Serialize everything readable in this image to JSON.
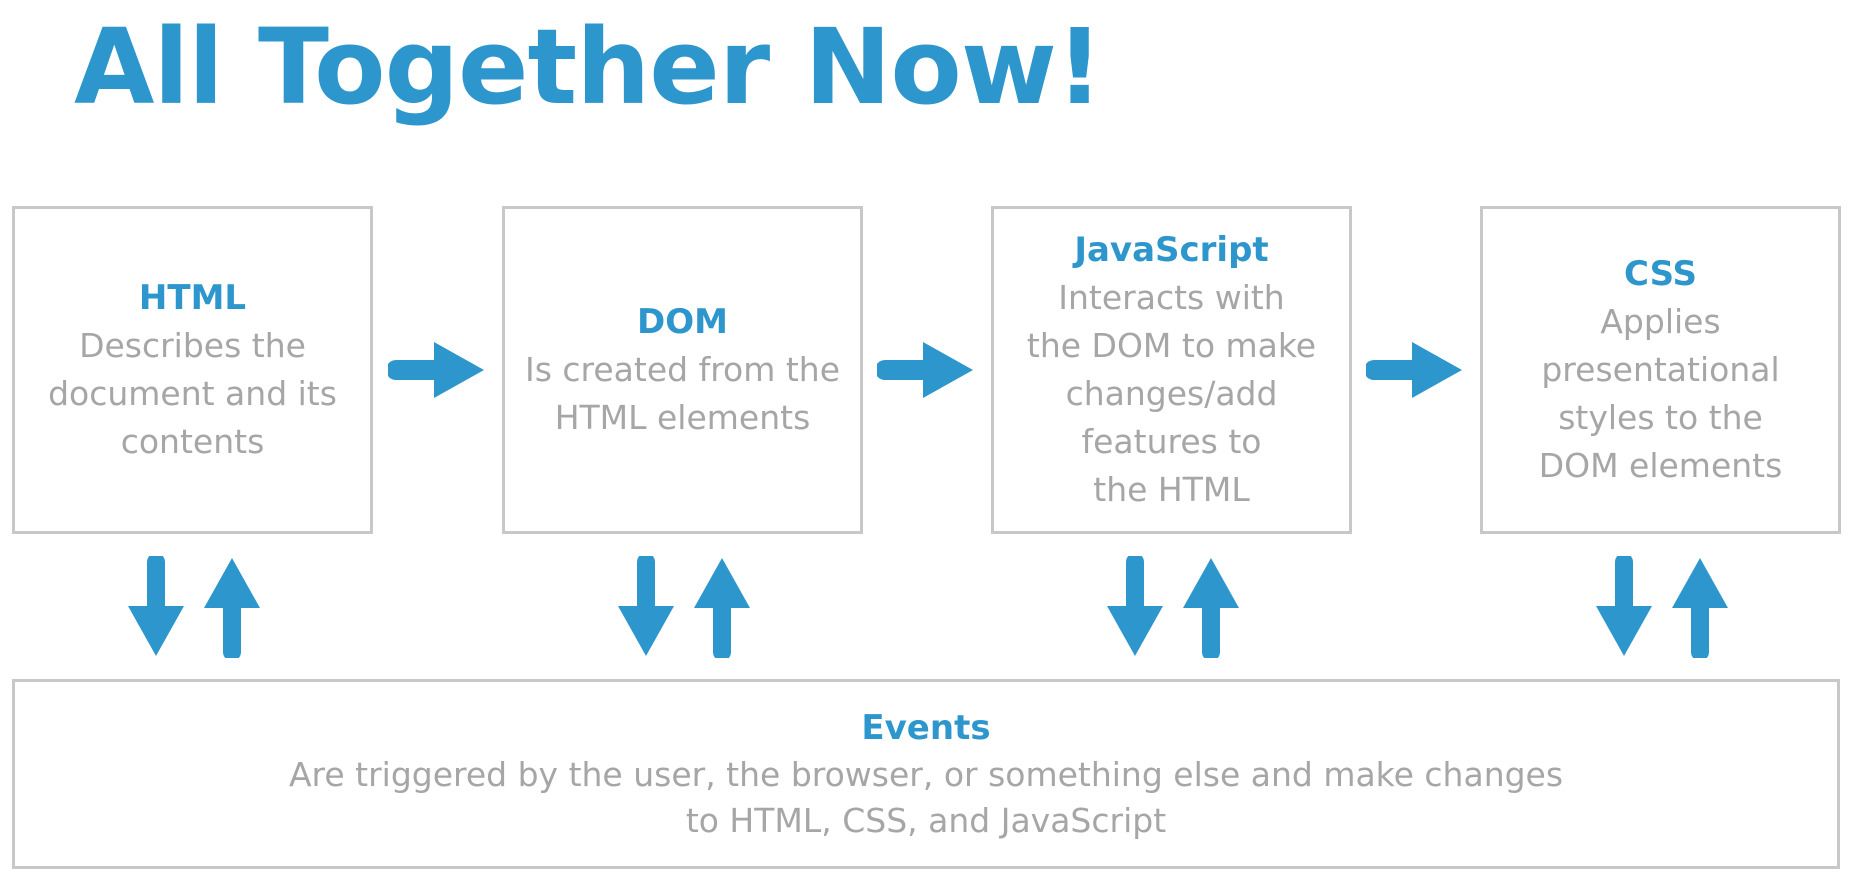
{
  "title": "All Together Now!",
  "accent_color": "#2d96cc",
  "steps": [
    {
      "heading": "HTML",
      "text": "Describes the\ndocument and its\ncontents"
    },
    {
      "heading": "DOM",
      "text": "Is created from the\nHTML elements"
    },
    {
      "heading": "JavaScript",
      "text": "Interacts with\nthe DOM to make\nchanges/add\nfeatures to\nthe HTML"
    },
    {
      "heading": "CSS",
      "text": "Applies\npresentational\nstyles to the\nDOM elements"
    }
  ],
  "events": {
    "heading": "Events",
    "text": "Are triggered by the user, the browser, or something else and make changes\nto HTML, CSS, and JavaScript"
  },
  "icons": {
    "flow_arrow": "arrow-right-icon",
    "down_arrow": "arrow-down-icon",
    "up_arrow": "arrow-up-icon"
  }
}
